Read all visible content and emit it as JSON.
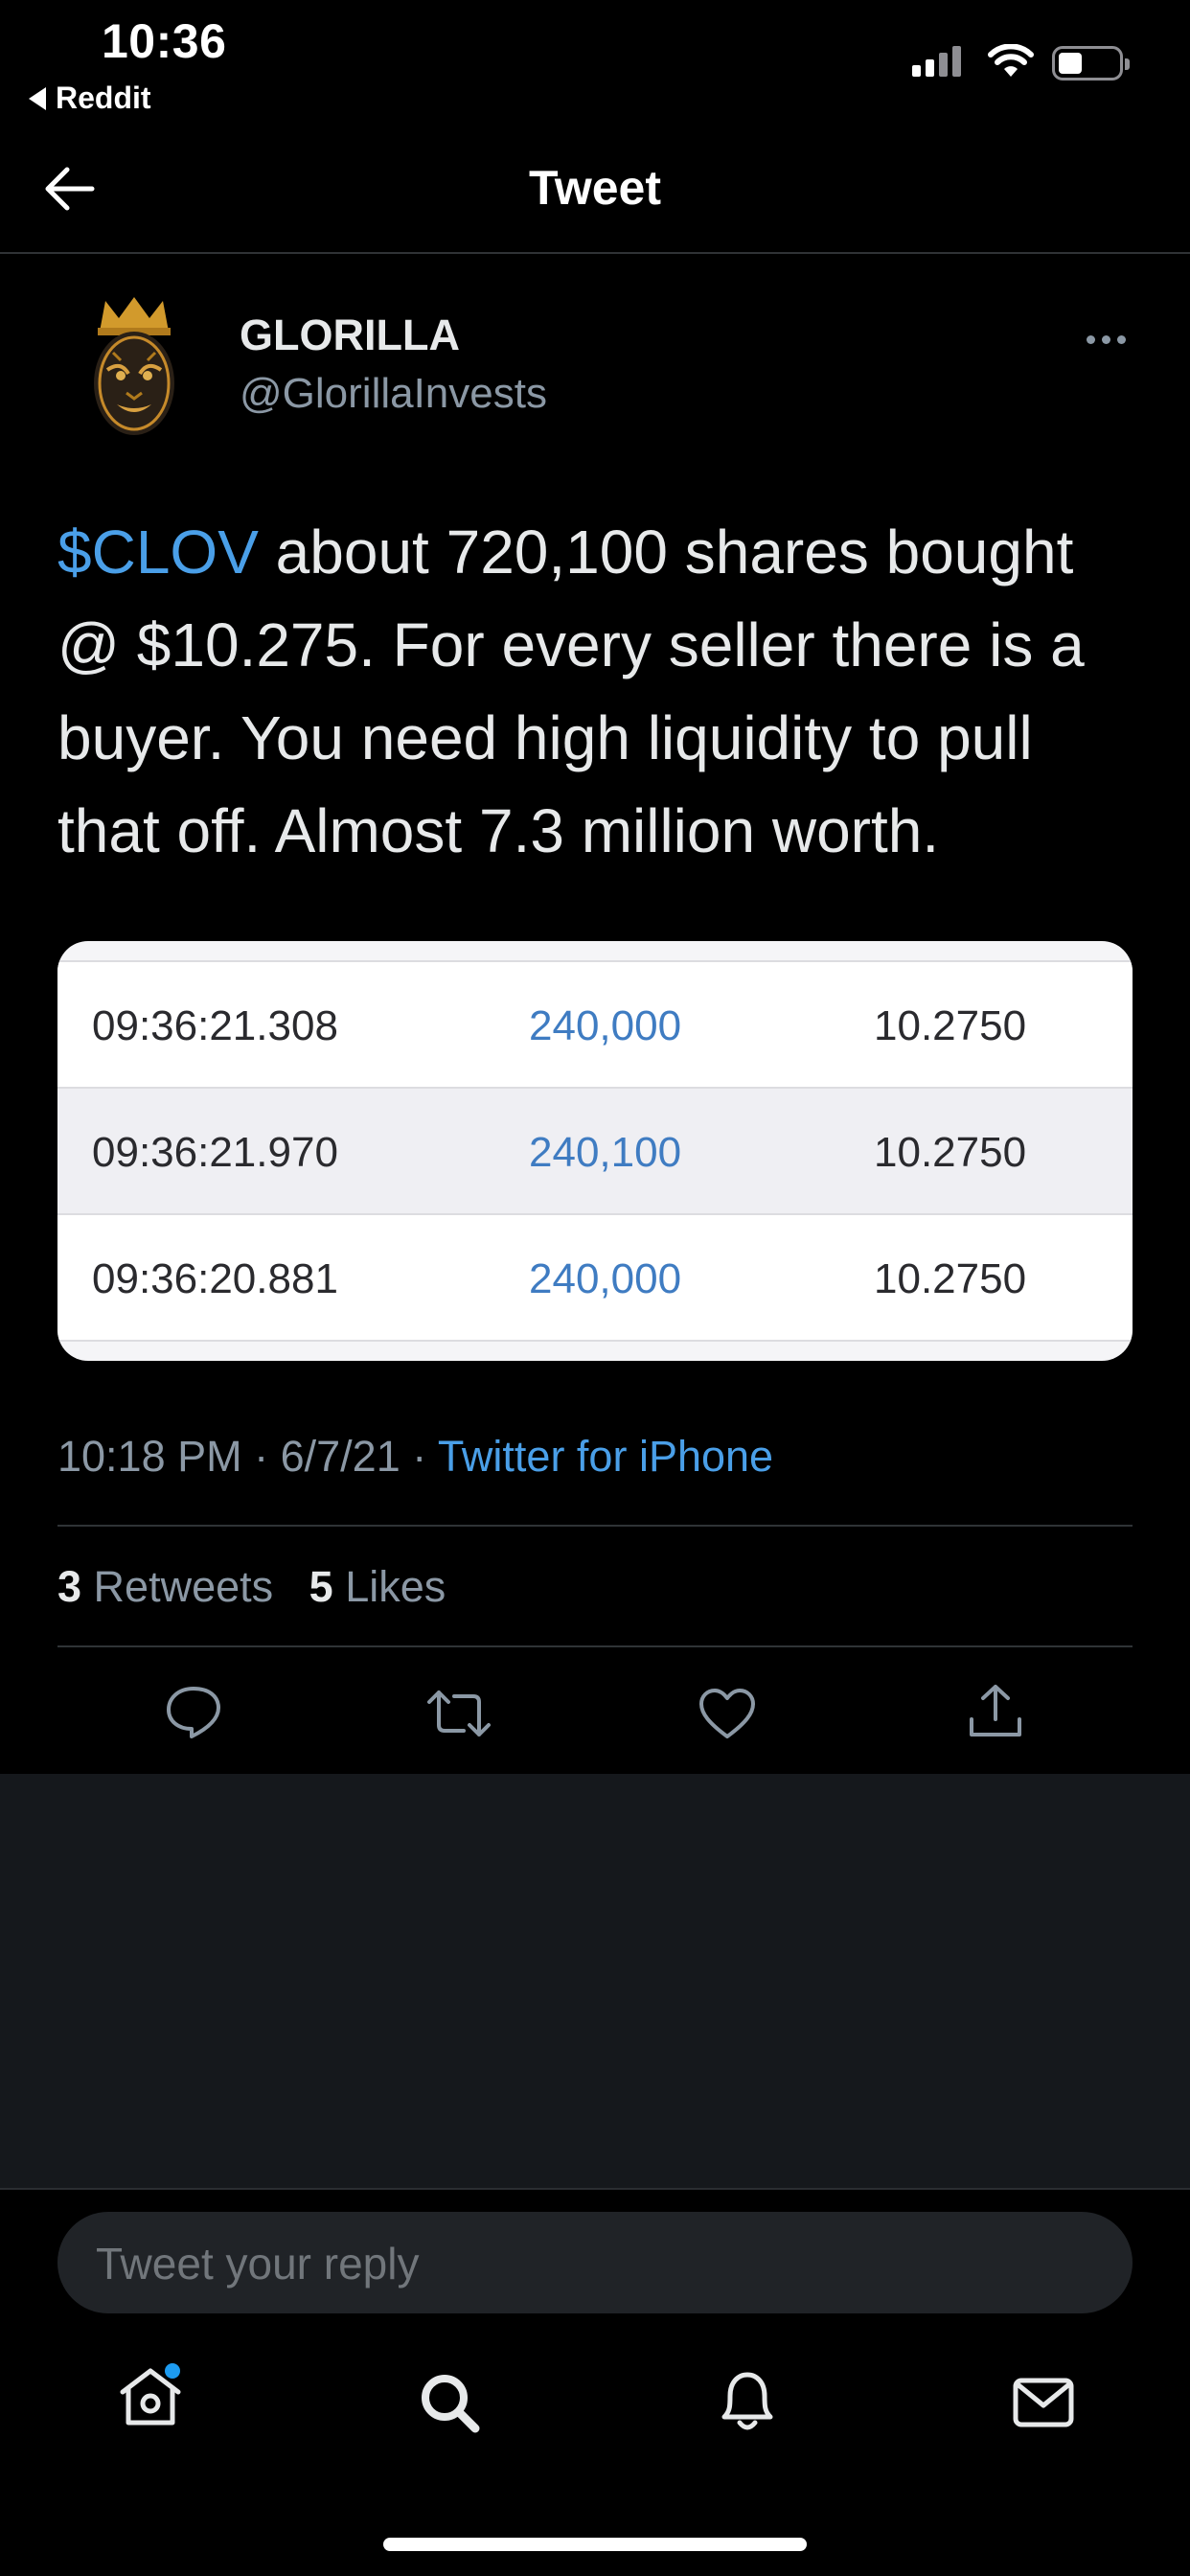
{
  "status_bar": {
    "time": "10:36",
    "back_app": "Reddit"
  },
  "nav": {
    "title": "Tweet"
  },
  "author": {
    "name": "GLORILLA",
    "handle": "@GlorillaInvests"
  },
  "tweet": {
    "cashtag": "$CLOV",
    "text": " about 720,100 shares bought @ $10.275. For every seller there is a buyer. You need high liquidity to pull that off. Almost 7.3 million worth."
  },
  "media_table": {
    "rows": [
      {
        "time": "09:36:21.308",
        "shares": "240,000",
        "price": "10.2750"
      },
      {
        "time": "09:36:21.970",
        "shares": "240,100",
        "price": "10.2750"
      },
      {
        "time": "09:36:20.881",
        "shares": "240,000",
        "price": "10.2750"
      }
    ]
  },
  "meta": {
    "timestamp": "10:18 PM · 6/7/21 · ",
    "source": "Twitter for iPhone"
  },
  "engagement": {
    "retweets": "3",
    "retweets_label": "Retweets",
    "likes": "5",
    "likes_label": "Likes"
  },
  "reply": {
    "placeholder": "Tweet your reply"
  },
  "colors": {
    "accent": "#4a9fe8",
    "background": "#000000",
    "secondary_text": "#8b98a5"
  },
  "icons": {
    "actions": [
      "reply-icon",
      "retweet-icon",
      "like-icon",
      "share-icon"
    ],
    "tabs": [
      "home-icon",
      "search-icon",
      "notifications-icon",
      "messages-icon"
    ]
  }
}
